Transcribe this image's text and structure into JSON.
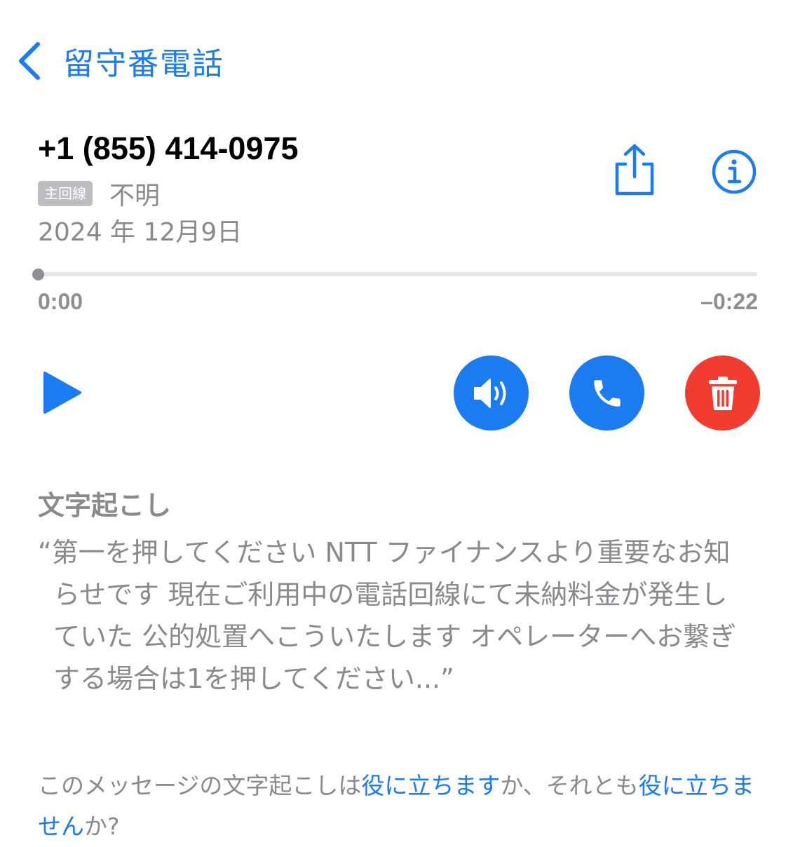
{
  "nav": {
    "back_label": "留守番電話"
  },
  "caller": {
    "number": "+1 (855) 414-0975",
    "line_badge": "主回線",
    "line_status": "不明",
    "date": "2024 年 12月9日"
  },
  "player": {
    "elapsed": "0:00",
    "remaining": "–0:22",
    "progress": 0
  },
  "transcription": {
    "title": "文字起こし",
    "text": "“第一を押してください NTT ファイナンスより重要なお知らせです 現在ご利用中の電話回線にて未納料金が発生していた 公的処置へこういたします オペレーターへお繋ぎする場合は1を押してください...”"
  },
  "feedback": {
    "prefix": "このメッセージの文字起こしは",
    "helpful_link": "役に立ちます",
    "middle": "か、それとも",
    "not_helpful_link": "役に立ちません",
    "suffix": "か?"
  },
  "colors": {
    "accent": "#1a7cf0",
    "danger": "#f23c30",
    "secondary_text": "#8a8a8e"
  },
  "icons": [
    "chevron-left-icon",
    "share-icon",
    "info-icon",
    "play-icon",
    "speaker-icon",
    "phone-icon",
    "trash-icon"
  ]
}
